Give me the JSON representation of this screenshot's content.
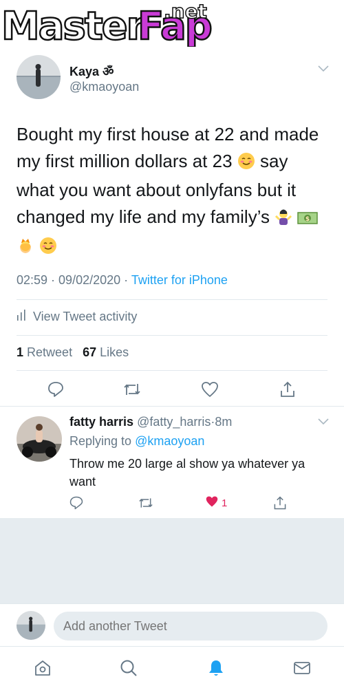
{
  "watermark": {
    "brand_a": "Master",
    "brand_b": "Fap",
    "brand_suffix": ".net"
  },
  "tweet": {
    "author_name": "Kaya ॐ",
    "author_handle": "@kmaoyoan",
    "text_lines": [
      "Bought my first house at 22 and made",
      "my first million dollars at 23",
      "say",
      "my first million dollars at 23 say what you want about onlyfans but it",
      "changed my life and my family’s"
    ],
    "line1": "Bought my first house at 22 and made",
    "line2a": "my first million dollars at 23 ",
    "line2b": " say",
    "line3": "what you want about onlyfans but it",
    "line4": "changed my life and my family’s ",
    "time": "02:59",
    "date": "09/02/2020",
    "separator": " · ",
    "source": "Twitter for iPhone",
    "activity_label": "View Tweet activity",
    "retweets_count": "1",
    "retweets_label": "Retweet",
    "likes_count": "67",
    "likes_label": "Likes"
  },
  "reply": {
    "author_name": "fatty harris",
    "author_handle": "@fatty_harris",
    "age": "8m",
    "replying_prefix": "Replying to ",
    "replying_handle": "@kmaoyoan",
    "text": "Throw me 20 large al show ya whatever ya want",
    "like_count": "1"
  },
  "compose": {
    "placeholder": "Add another Tweet"
  },
  "colors": {
    "accent": "#1da1f2",
    "muted": "#657786",
    "like": "#e0245e"
  },
  "icons": [
    "chevron-down-icon",
    "reply-icon",
    "retweet-icon",
    "heart-icon",
    "share-icon",
    "home-icon",
    "search-icon",
    "notifications-icon",
    "messages-icon",
    "activity-bars-icon"
  ]
}
